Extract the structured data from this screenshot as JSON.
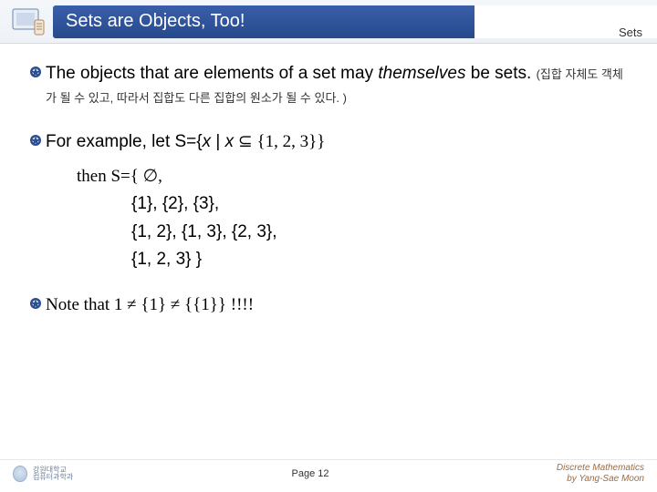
{
  "header": {
    "title": "Sets are Objects, Too!",
    "section": "Sets"
  },
  "bullets": {
    "b1a": "The objects that are elements of a set may ",
    "b1b": "themselves",
    "b1c": " be sets. ",
    "b1k": "(집합 자체도 객체가 될 수 있고, 따라서 집합도 다른 집합의 원소가 될 수 있다. )",
    "b2a": "For example, let S={",
    "b2x1": "x",
    "b2m": " | ",
    "b2x2": "x",
    "b2s": " ⊆ {1, 2, 3}}",
    "thenS": "then S={ ∅,",
    "l2": "{1}, {2}, {3},",
    "l3": "{1, 2}, {1, 3}, {2, 3},",
    "l4": "{1, 2, 3} }",
    "b3": "Note that 1 ≠ {1} ≠ {{1}} !!!!"
  },
  "footer": {
    "page": "Page 12",
    "credit1": "Discrete Mathematics",
    "credit2": "by Yang-Sae Moon",
    "univ1": "강원대학교",
    "univ2": "컴퓨터과학과"
  }
}
